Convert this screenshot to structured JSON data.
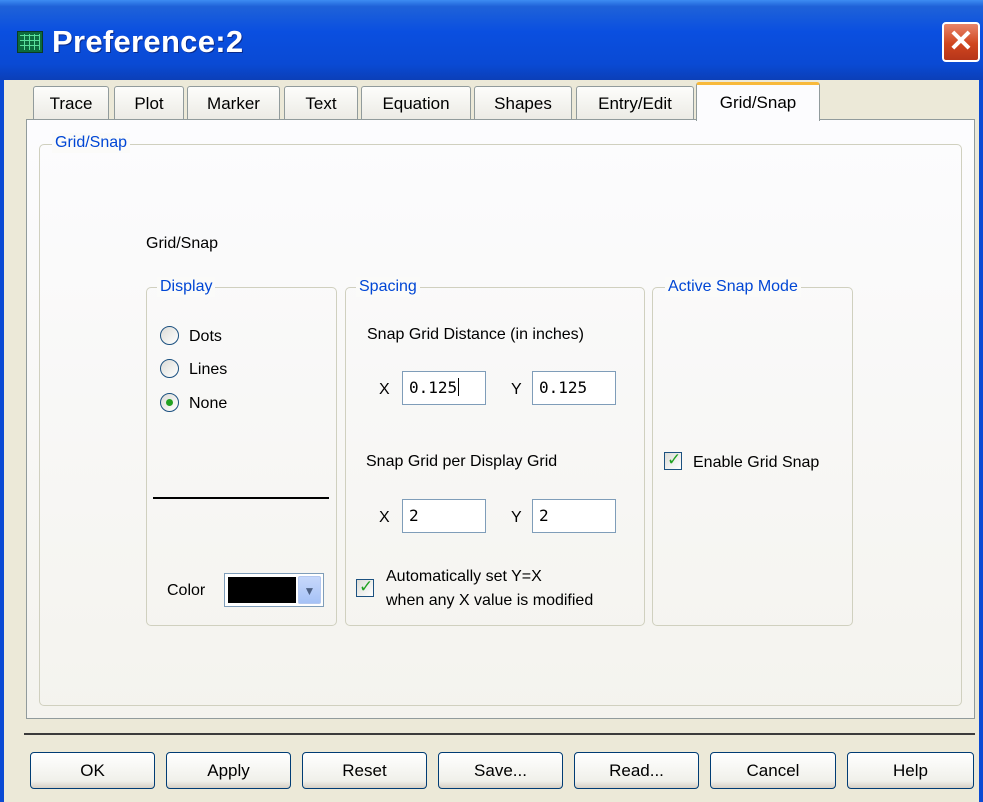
{
  "window": {
    "title": "Preference:2",
    "close_glyph": "✕"
  },
  "tabs": [
    {
      "label": "Trace",
      "active": false
    },
    {
      "label": "Plot",
      "active": false
    },
    {
      "label": "Marker",
      "active": false
    },
    {
      "label": "Text",
      "active": false
    },
    {
      "label": "Equation",
      "active": false
    },
    {
      "label": "Shapes",
      "active": false
    },
    {
      "label": "Entry/Edit",
      "active": false
    },
    {
      "label": "Grid/Snap",
      "active": true
    }
  ],
  "page": {
    "group_title": "Grid/Snap",
    "heading": "Grid/Snap",
    "display": {
      "title": "Display",
      "options": [
        {
          "label": "Dots",
          "checked": false
        },
        {
          "label": "Lines",
          "checked": false
        },
        {
          "label": "None",
          "checked": true
        }
      ],
      "color_label": "Color",
      "color_value": "#000000"
    },
    "spacing": {
      "title": "Spacing",
      "snap_distance_label": "Snap Grid Distance (in inches)",
      "snap_distance": {
        "x_label": "X",
        "x": "0.125",
        "y_label": "Y",
        "y": "0.125"
      },
      "per_display_label": "Snap Grid per Display Grid",
      "per_display": {
        "x_label": "X",
        "x": "2",
        "y_label": "Y",
        "y": "2"
      },
      "auto_line1": "Automatically set  Y=X",
      "auto_line2": "when any X value is modified",
      "auto_checked": true
    },
    "active_snap": {
      "title": "Active Snap Mode",
      "enable_label": "Enable Grid Snap",
      "enable_checked": true
    }
  },
  "buttons": {
    "ok": "OK",
    "apply": "Apply",
    "reset": "Reset",
    "save": "Save...",
    "read": "Read...",
    "cancel": "Cancel",
    "help": "Help"
  },
  "colors": {
    "title_bar": "#0a4ad4",
    "legend_text": "#0046d5",
    "active_tab_accent": "#f8b93b",
    "check_green": "#21a121"
  }
}
